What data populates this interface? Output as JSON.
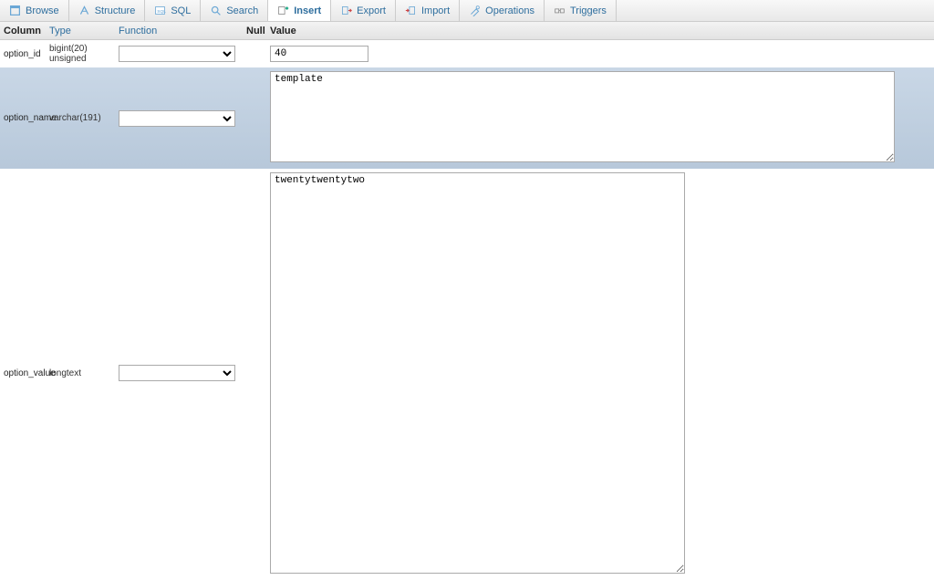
{
  "tabs": {
    "browse": "Browse",
    "structure": "Structure",
    "sql": "SQL",
    "search": "Search",
    "insert": "Insert",
    "export": "Export",
    "import": "Import",
    "operations": "Operations",
    "triggers": "Triggers",
    "active": "insert"
  },
  "headers": {
    "column": "Column",
    "type": "Type",
    "function": "Function",
    "null": "Null",
    "value": "Value"
  },
  "rows": [
    {
      "name": "option_id",
      "type": "bigint(20) unsigned",
      "function": "",
      "value": "40",
      "kind": "text"
    },
    {
      "name": "option_name",
      "type": "varchar(191)",
      "function": "",
      "value": "template",
      "kind": "textarea-med"
    },
    {
      "name": "option_value",
      "type": "longtext",
      "function": "",
      "value": "twentytwentytwo",
      "kind": "textarea-lg"
    }
  ]
}
